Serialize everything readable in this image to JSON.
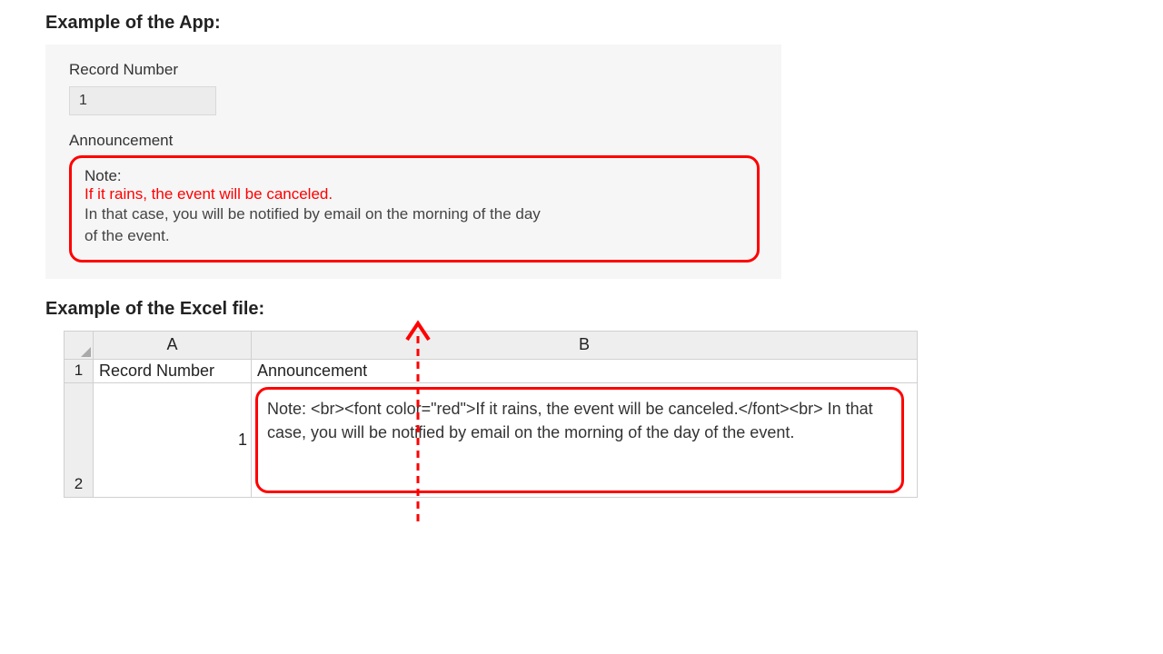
{
  "headings": {
    "app": "Example of the App:",
    "excel": "Example of the Excel file:"
  },
  "app": {
    "record_number_label": "Record Number",
    "record_number_value": "1",
    "announcement_label": "Announcement",
    "note_title": "Note:",
    "note_red": "If it rains, the event will be canceled.",
    "note_body_line1": "In that case, you will be notified by email on the morning of the day",
    "note_body_line2": "of the event."
  },
  "excel": {
    "colA": "A",
    "colB": "B",
    "row1": "1",
    "row2": "2",
    "a1": "Record Number",
    "b1": "Announcement",
    "a2": "1",
    "b2": "Note: <br><font color=\"red\">If it rains, the event will be canceled.</font><br> In that case, you will be notified by email on the morning of the day of the event."
  }
}
